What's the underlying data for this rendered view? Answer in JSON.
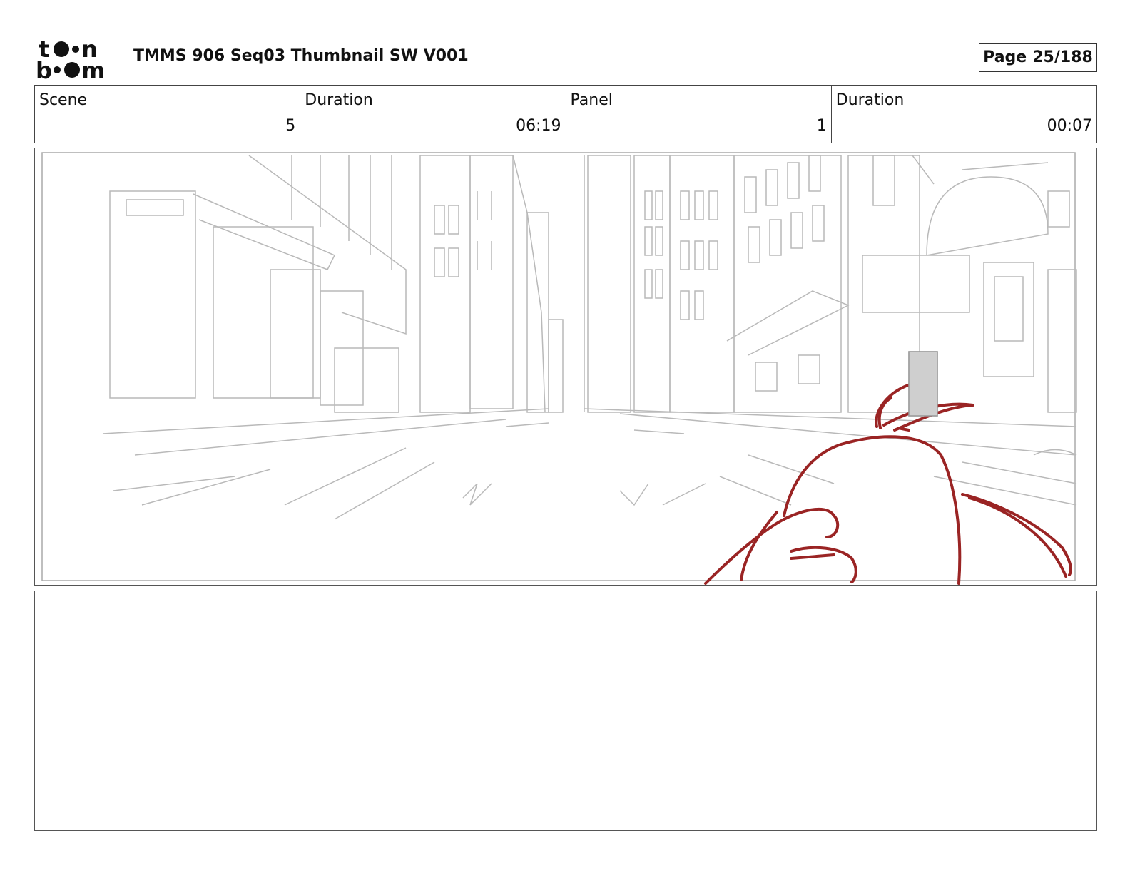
{
  "header": {
    "logo_text": "toon boom",
    "title": "TMMS 906 Seq03 Thumbnail SW V001",
    "page_label": "Page",
    "page_value": "25/188"
  },
  "info": {
    "scene_label": "Scene",
    "scene_value": "5",
    "scene_duration_label": "Duration",
    "scene_duration_value": "06:19",
    "panel_label": "Panel",
    "panel_value": "1",
    "panel_duration_label": "Duration",
    "panel_duration_value": "00:07"
  },
  "panel": {
    "sketch_color": "#b9b9b9",
    "character_color": "#9a2424"
  },
  "notes": {
    "text": ""
  }
}
